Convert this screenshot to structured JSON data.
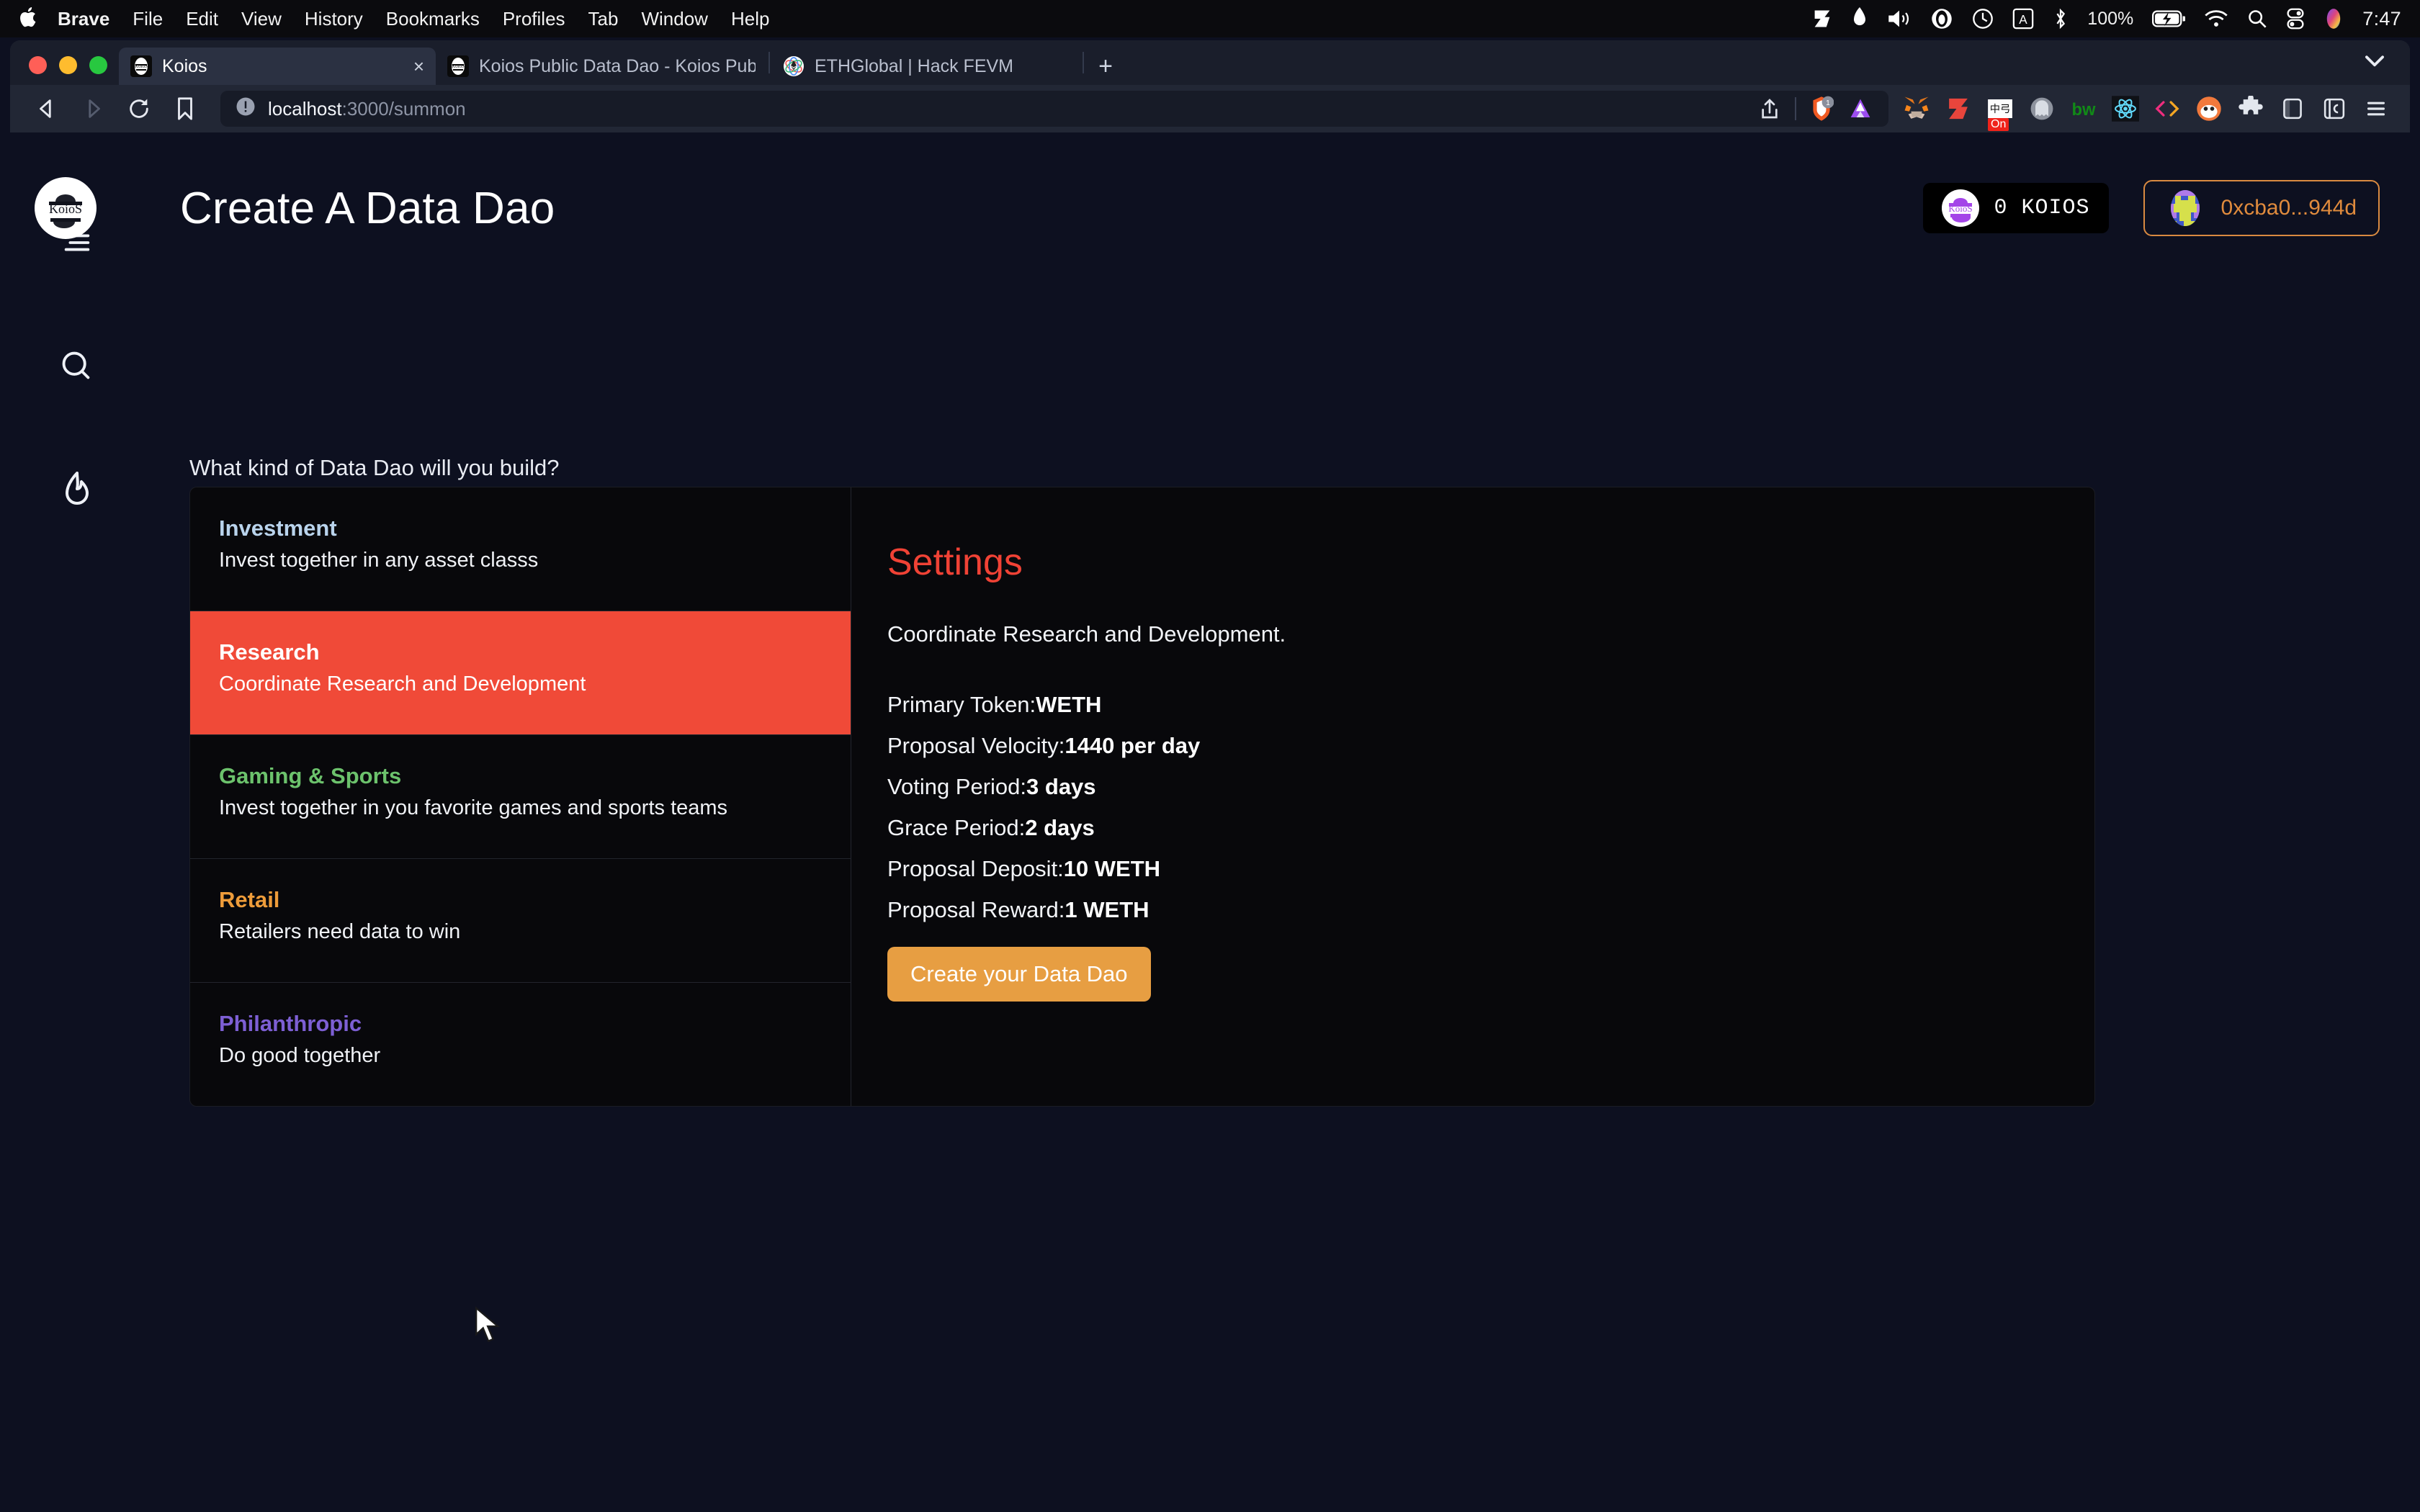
{
  "os_menubar": {
    "apple_icon": "apple-logo-icon",
    "items": [
      {
        "label": "Brave",
        "bold": true
      },
      {
        "label": "File",
        "bold": false
      },
      {
        "label": "Edit",
        "bold": false
      },
      {
        "label": "View",
        "bold": false
      },
      {
        "label": "History",
        "bold": false
      },
      {
        "label": "Bookmarks",
        "bold": false
      },
      {
        "label": "Profiles",
        "bold": false
      },
      {
        "label": "Tab",
        "bold": false
      },
      {
        "label": "Window",
        "bold": false
      },
      {
        "label": "Help",
        "bold": false
      }
    ],
    "status_icons": [
      "zerion-icon",
      "flame-icon",
      "volume-icon",
      "malwarebytes-icon",
      "time-machine-icon",
      "keyboard-input-icon",
      "bluetooth-icon"
    ],
    "battery_percent": "100%",
    "battery_icon": "battery-charging-icon",
    "wifi_icon": "wifi-icon",
    "spotlight_icon": "search-icon",
    "control_center_icon": "control-center-icon",
    "siri_icon": "siri-icon",
    "clock": "7:47"
  },
  "browser": {
    "tabs": [
      {
        "title": "Koios",
        "favicon": "koios-favicon",
        "active": true,
        "close_label": "×"
      },
      {
        "title": "Koios Public Data Dao - Koios Public",
        "favicon": "koios-favicon",
        "active": false
      },
      {
        "title": "ETHGlobal | Hack FEVM",
        "favicon": "ethglobal-favicon",
        "active": false
      }
    ],
    "new_tab_label": "+",
    "tab_list_icon": "chevron-down-icon",
    "nav": {
      "back_icon": "back-arrow-icon",
      "forward_icon": "forward-arrow-icon",
      "reload_icon": "reload-icon",
      "bookmark_icon": "bookmark-icon"
    },
    "omnibox": {
      "security_icon": "not-secure-info-icon",
      "url_host": "localhost",
      "url_path": ":3000/summon",
      "full_url": "localhost:3000/summon"
    },
    "omnibox_actions": {
      "share_icon": "share-icon",
      "brave_shield_icon": "brave-shields-icon",
      "shield_count": "1",
      "brave_rewards_icon": "brave-rewards-triangle-icon"
    },
    "extensions": [
      "metamask-fox-icon",
      "zerion-icon",
      "pinyin-input-icon",
      "ghost-icon",
      "bitwarden-icon",
      "react-devtools-icon",
      "code-brackets-icon",
      "rabby-wallet-icon",
      "puzzle-extensions-icon",
      "sidebar-toggle-icon",
      "reading-list-icon",
      "brave-menu-icon"
    ],
    "pinyin_badge": "On"
  },
  "app": {
    "logo_icon": "koios-logo-icon",
    "logo_text": "KoioS",
    "title": "Create A Data Dao",
    "token_balance": {
      "icon": "koios-token-icon",
      "amount": "0 KOIOS"
    },
    "wallet": {
      "avatar_icon": "wallet-avatar-icon",
      "address": "0xcba0...944d"
    },
    "rail_icons": [
      "hamburger-menu-icon",
      "search-icon",
      "flame-icon"
    ],
    "question": "What kind of Data Dao will you build?",
    "dao_types": [
      {
        "name": "Investment",
        "name_color": "#b9d3ec",
        "description": "Invest together in any asset classs",
        "selected": false
      },
      {
        "name": "Research",
        "name_color": "#ffffff",
        "description": "Coordinate Research and Development",
        "selected": true
      },
      {
        "name": "Gaming & Sports",
        "name_color": "#6cc26c",
        "description": "Invest together in you favorite games and sports teams",
        "selected": false
      },
      {
        "name": "Retail",
        "name_color": "#ee9c3a",
        "description": "Retailers need data to win",
        "selected": false
      },
      {
        "name": "Philanthropic",
        "name_color": "#7d5fd4",
        "description": "Do good together",
        "selected": false
      }
    ],
    "settings": {
      "heading": "Settings",
      "subtitle": "Coordinate Research and Development.",
      "rows": [
        {
          "label": "Primary Token:",
          "value": "WETH"
        },
        {
          "label": "Proposal Velocity:",
          "value": "1440 per day"
        },
        {
          "label": "Voting Period:",
          "value": "3 days"
        },
        {
          "label": "Grace Period:",
          "value": "2 days"
        },
        {
          "label": "Proposal Deposit:",
          "value": "10 WETH"
        },
        {
          "label": "Proposal Reward:",
          "value": "1 WETH"
        }
      ],
      "create_button": "Create your Data Dao"
    },
    "colors": {
      "accent_red": "#f04a38",
      "accent_orange": "#e79e42",
      "wallet_border": "#d98a41",
      "page_bg": "#0d1020",
      "panel_bg": "#08080b"
    }
  }
}
